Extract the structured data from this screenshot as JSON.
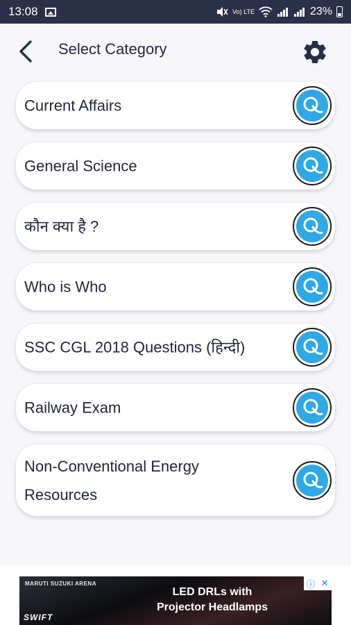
{
  "status_bar": {
    "time": "13:08",
    "volte_label": "Vo) LTE",
    "battery": "23%"
  },
  "header": {
    "title": "Select Category"
  },
  "categories": [
    "Current Affairs",
    "General Science",
    "कौन क्या है ?",
    "Who is Who",
    "SSC CGL 2018 Questions (हिन्दी)",
    "Railway Exam",
    "Non-Conventional Energy Resources"
  ],
  "icons": {
    "back": "chevron-left-icon",
    "settings": "gear-icon",
    "category": "quiz-q-icon"
  },
  "colors": {
    "status_bar": "#2a3049",
    "accent": "#2fa8e6",
    "background": "#f7f7fb"
  },
  "ad": {
    "brand": "MARUTI SUZUKI ARENA",
    "model": "SWIFT",
    "headline_line1": "LED DRLs with",
    "headline_line2": "Projector Headlamps"
  }
}
